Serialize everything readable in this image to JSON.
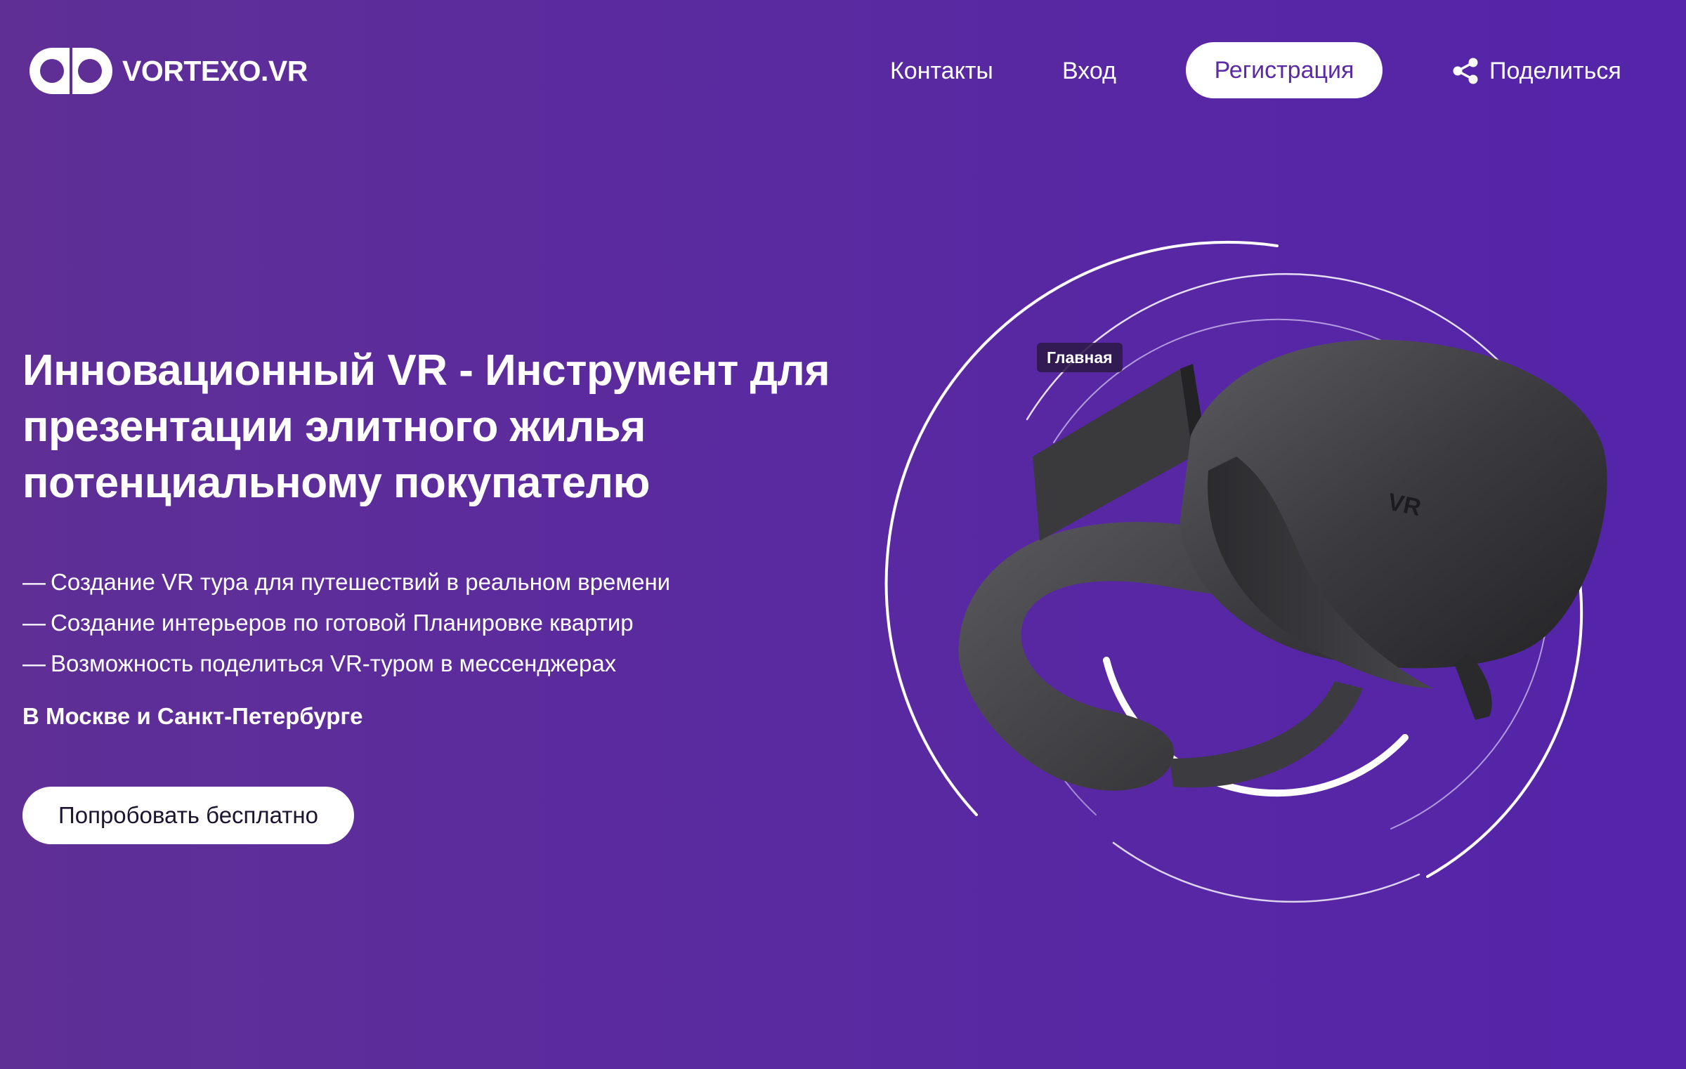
{
  "header": {
    "logo_text": "VORTEXO.VR",
    "nav": {
      "contacts": "Контакты",
      "login": "Вход"
    },
    "register_label": "Регистрация",
    "share_label": "Поделиться"
  },
  "hero": {
    "title": "Инновационный VR - Инструмент для презентации элитного жилья потенциальному покупателю",
    "features": [
      {
        "dash": "—",
        "text": "Создание VR тура для путешествий в реальном времени"
      },
      {
        "dash": "—",
        "text": "Создание интерьеров по готовой Планировке квартир"
      },
      {
        "dash": "—",
        "text": "Возможность поделиться VR-туром в мессенджерах"
      }
    ],
    "cities": "В Москве и Санкт-Петербурге",
    "cta_label": "Попробовать бесплатно",
    "tooltip": "Главная",
    "headset_label": "VR"
  },
  "colors": {
    "background_left": "#5f2f96",
    "background_right": "#5424aa",
    "accent": "#5a2ba3",
    "button_bg": "#ffffff"
  },
  "icons": {
    "logo": "vr-goggles-logo-icon",
    "share": "share-icon"
  }
}
